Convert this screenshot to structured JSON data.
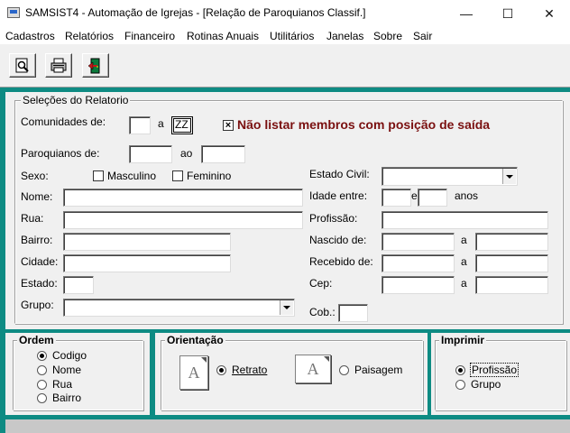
{
  "window": {
    "title": "SAMSIST4 - Automação de Igrejas - [Relação de Paroquianos Classif.]",
    "minimize": "—",
    "maximize": "☐",
    "close": "✕"
  },
  "menu": [
    "Cadastros",
    "Relatórios",
    "Financeiro",
    "Rotinas Anuais",
    "Utilitários",
    "Janelas",
    "Sobre",
    "Sair"
  ],
  "toolbar": {
    "icons": [
      "preview-icon",
      "printer-icon",
      "exit-door-icon"
    ]
  },
  "selecoes": {
    "title": "Seleções do Relatorio",
    "comunidades_label": "Comunidades de:",
    "comunidades_from": "",
    "comunidades_sep": "a",
    "comunidades_to": "ZZ",
    "nao_listar_label": "Não listar membros com posição de saída",
    "nao_listar_checked": "×",
    "paroquianos_label": "Paroquianos de:",
    "paroquianos_from": "",
    "paroquianos_sep": "ao",
    "paroquianos_to": "",
    "sexo_label": "Sexo:",
    "masculino_label": "Masculino",
    "feminino_label": "Feminino",
    "estado_civil_label": "Estado Civil:",
    "estado_civil_value": "",
    "nome_label": "Nome:",
    "nome_value": "",
    "idade_label": "Idade entre:",
    "idade_from": "",
    "idade_sep": "e",
    "idade_to": "",
    "idade_unit": "anos",
    "rua_label": "Rua:",
    "rua_value": "",
    "profissao_label": "Profissão:",
    "profissao_value": "",
    "bairro_label": "Bairro:",
    "bairro_value": "",
    "nascido_label": "Nascido de:",
    "nascido_from": "",
    "nascido_sep": "a",
    "nascido_to": "",
    "cidade_label": "Cidade:",
    "cidade_value": "",
    "recebido_label": "Recebido de:",
    "recebido_from": "",
    "recebido_sep": "a",
    "recebido_to": "",
    "estado_label": "Estado:",
    "estado_value": "",
    "cep_label": "Cep:",
    "cep_from": "",
    "cep_sep": "a",
    "cep_to": "",
    "grupo_label": "Grupo:",
    "grupo_value": "",
    "cob_label": "Cob.:",
    "cob_value": ""
  },
  "ordem": {
    "title": "Ordem",
    "options": [
      "Codigo",
      "Nome",
      "Rua",
      "Bairro"
    ],
    "selected": "Codigo"
  },
  "orientacao": {
    "title": "Orientação",
    "retrato_label": "Retrato",
    "paisagem_label": "Paisagem",
    "icon_letter": "A",
    "selected": "Retrato"
  },
  "imprimir": {
    "title": "Imprimir",
    "options": [
      "Profissão",
      "Grupo"
    ],
    "selected": "Profissão"
  },
  "colors": {
    "background": "#0e8b83",
    "panel": "#f0f0f0",
    "warning_text": "#7a1010"
  }
}
